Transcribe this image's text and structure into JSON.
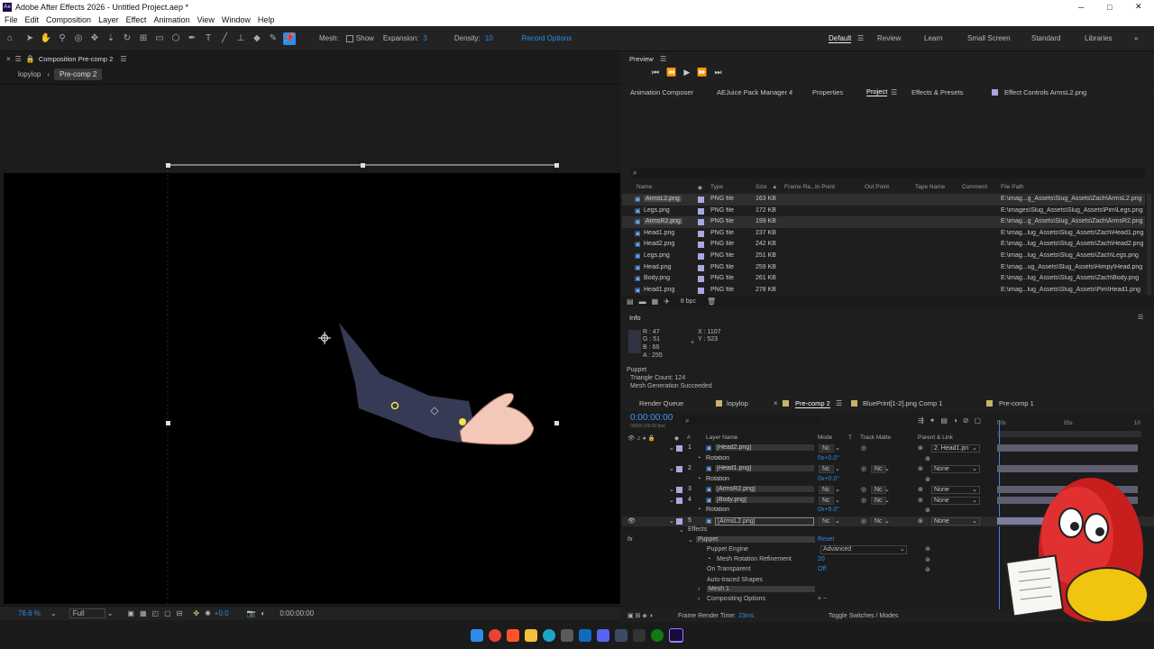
{
  "window": {
    "title": "Adobe After Effects 2026 - Untitled Project.aep *",
    "minimize": "─",
    "maximize": "□",
    "close": "✕"
  },
  "menu": [
    "File",
    "Edit",
    "Composition",
    "Layer",
    "Effect",
    "Animation",
    "View",
    "Window",
    "Help"
  ],
  "toolbar": {
    "mesh_label": "Mesh:",
    "show_label": "Show",
    "expansion_label": "Expansion:",
    "expansion_value": "3",
    "density_label": "Density:",
    "density_value": "10",
    "record_options": "Record Options",
    "workspaces": [
      "Default",
      "Review",
      "Learn",
      "Small Screen",
      "Standard",
      "Libraries"
    ],
    "more": "»"
  },
  "composition": {
    "panel_title": "Composition Pre-comp 2",
    "breadcrumbs": [
      "lopylop",
      "Pre-comp 2"
    ],
    "footer": {
      "zoom": "76.6 %",
      "resolution": "Full",
      "exposure": "+0.0",
      "timecode": "0:00:00:00"
    }
  },
  "preview": {
    "title": "Preview"
  },
  "panel_tabs": [
    "Animation Composer",
    "AEJuice Pack Manager 4",
    "Properties",
    "Project",
    "Effects & Presets",
    "Effect Controls ArmsL2.png"
  ],
  "project": {
    "columns": [
      "Name",
      "Type",
      "Size",
      "Frame Ra...",
      "In Point",
      "Out Point",
      "Tape Name",
      "Comment",
      "File Path"
    ],
    "rows": [
      {
        "name": "ArmsL2.png",
        "type": "PNG file",
        "size": "163 KB",
        "path": "E:\\imag...g_Assets\\Slug_Assets\\Zach\\ArmsL2.png",
        "sel": true
      },
      {
        "name": "Legs.png",
        "type": "PNG file",
        "size": "172 KB",
        "path": "E:\\images\\Slug_Assets\\Slug_Assets\\Pim\\Legs.png",
        "sel": false
      },
      {
        "name": "ArmsR2.png",
        "type": "PNG file",
        "size": "199 KB",
        "path": "E:\\imag...g_Assets\\Slug_Assets\\Zach\\ArmsR2.png",
        "sel": true
      },
      {
        "name": "Head1.png",
        "type": "PNG file",
        "size": "237 KB",
        "path": "E:\\imag...lug_Assets\\Slug_Assets\\Zach\\Head1.png",
        "sel": false
      },
      {
        "name": "Head2.png",
        "type": "PNG file",
        "size": "242 KB",
        "path": "E:\\imag...lug_Assets\\Slug_Assets\\Zach\\Head2.png",
        "sel": false
      },
      {
        "name": "Legs.png",
        "type": "PNG file",
        "size": "251 KB",
        "path": "E:\\imag...lug_Assets\\Slug_Assets\\Zach\\Legs.png",
        "sel": false
      },
      {
        "name": "Head.png",
        "type": "PNG file",
        "size": "259 KB",
        "path": "E:\\imag...ug_Assets\\Slug_Assets\\Himpy\\Head.png",
        "sel": false
      },
      {
        "name": "Body.png",
        "type": "PNG file",
        "size": "261 KB",
        "path": "E:\\imag...lug_Assets\\Slug_Assets\\Zach\\Body.png",
        "sel": false
      },
      {
        "name": "Head1.png",
        "type": "PNG file",
        "size": "278 KB",
        "path": "E:\\imag...lug_Assets\\Slug_Assets\\Pim\\Head1.png",
        "sel": false
      }
    ],
    "bpc": "8 bpc"
  },
  "info": {
    "title": "Info",
    "r": "R : 47",
    "g": "G : 51",
    "b": "B : 66",
    "a": "A : 255",
    "x": "X : 1107",
    "y": "Y : 523",
    "line1": "Puppet",
    "line2": "Triangle Count: 124",
    "line3": "Mesh Generation Succeeded"
  },
  "timeline": {
    "tabs": [
      "Render Queue",
      "lopylop",
      "Pre-comp 2",
      "BluePrint[1-2].png Comp 1",
      "Pre-comp 1"
    ],
    "timecode": "0:00:00:00",
    "fps": "00000 (60.00 fps)",
    "ruler": [
      "00s",
      "05s",
      "10"
    ],
    "headers": {
      "layer_name": "Layer Name",
      "mode": "Mode",
      "t": "T",
      "track_matte": "Track Matte",
      "parent": "Parent & Link"
    },
    "layers": [
      {
        "num": "1",
        "name": "[Head2.png]",
        "mode": "Nc",
        "matte": "",
        "parent": "2. Head1.pn",
        "rot": "0x+0.0°"
      },
      {
        "num": "2",
        "name": "[Head1.png]",
        "mode": "Nc",
        "matte": "Nc",
        "parent": "None",
        "rot": "0x+0.0°"
      },
      {
        "num": "3",
        "name": "[ArmsR2.png]",
        "mode": "Nc",
        "matte": "Nc",
        "parent": "None",
        "rot": ""
      },
      {
        "num": "4",
        "name": "[Body.png]",
        "mode": "Nc",
        "matte": "Nc",
        "parent": "None",
        "rot": "0x+0.0°"
      },
      {
        "num": "5",
        "name": "[ArmsL2.png]",
        "mode": "Nc",
        "matte": "Nc",
        "parent": "None",
        "rot": ""
      }
    ],
    "rotation_label": "Rotation",
    "effects": {
      "effects_label": "Effects",
      "puppet": "Puppet",
      "reset": "Reset",
      "engine_label": "Puppet Engine",
      "engine_value": "Advanced",
      "mesh_rot_label": "Mesh Rotation Refinement",
      "mesh_rot_value": "20",
      "on_transparent_label": "On Transparent",
      "on_transparent_value": "Off",
      "auto_traced": "Auto-traced Shapes",
      "mesh1": "Mesh 1",
      "compositing": "Compositing Options"
    },
    "footer": {
      "render_time_label": "Frame Render Time:",
      "render_time_value": "23ms",
      "toggle": "Toggle Switches / Modes"
    }
  },
  "colors": {
    "accent": "#2d8ceb",
    "timecode": "#3b9cf6",
    "selection": "#5a5a7a",
    "layer_bar": "#6e6e8a"
  }
}
